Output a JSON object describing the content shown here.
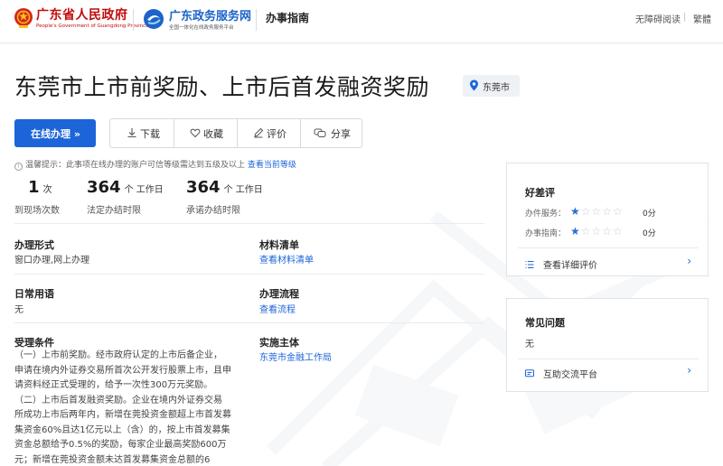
{
  "header": {
    "gov_title": "广东省人民政府",
    "gov_subtitle": "People's Government of Guangdong Province",
    "portal_title": "广东政务服务网",
    "portal_subtitle": "全国一体化在线政务服务平台",
    "section": "办事指南",
    "accessibility": "无障碍阅读",
    "traditional": "繁體"
  },
  "page": {
    "title": "东莞市上市前奖励、上市后首发融资奖励",
    "location": "东莞市"
  },
  "actions": {
    "online": "在线办理 »",
    "download": "下载",
    "favorite": "收藏",
    "review": "评价",
    "share": "分享"
  },
  "tip": {
    "text": "温馨提示：此事项在线办理的账户可信等级需达到五级及以上",
    "link": "查看当前等级"
  },
  "stats": [
    {
      "num": "1",
      "unit": "次",
      "caption": "到现场次数"
    },
    {
      "num": "364",
      "unit": "个 工作日",
      "caption": "法定办结时限"
    },
    {
      "num": "364",
      "unit": "个 工作日",
      "caption": "承诺办结时限"
    }
  ],
  "info": {
    "method_label": "办理形式",
    "method_value": "窗口办理,网上办理",
    "materials_label": "材料清单",
    "materials_link": "查看材料清单",
    "terms_label": "日常用语",
    "terms_value": "无",
    "process_label": "办理流程",
    "process_link": "查看流程",
    "conditions_label": "受理条件",
    "conditions_lines": [
      "（一）上市前奖励。经市政府认定的上市后备企业，",
      "申请在境内外证券交易所首次公开发行股票上市，且申",
      "请资料经正式受理的，给予一次性300万元奖励。",
      "（二）上市后首发融资奖励。企业在境内外证券交易",
      "所成功上市后两年内，新增在莞投资金额超上市首发募",
      "集资金60%且达1亿元以上（含）的，按上市首发募集",
      "资金总额给予0.5%的奖励，每家企业最高奖励600万",
      "元；新增在莞投资金额未达首发募集资金总额的6"
    ],
    "entity_label": "实施主体",
    "entity_link": "东莞市金融工作局"
  },
  "rating": {
    "title": "好差评",
    "service_label": "办件服务：",
    "service_score": "0分",
    "guide_label": "办事指南：",
    "guide_score": "0分",
    "stars_filled": 1,
    "stars_total": 5,
    "detail_link": "查看详细评价"
  },
  "faq": {
    "title": "常见问题",
    "value": "无",
    "platform_link": "互助交流平台"
  }
}
